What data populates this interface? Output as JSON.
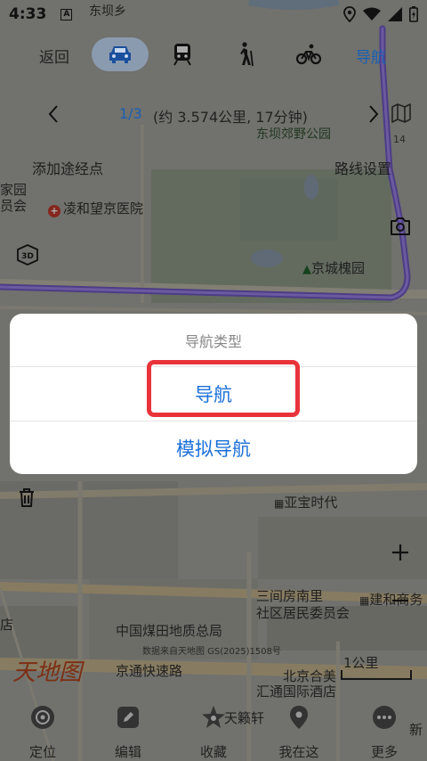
{
  "status_bar": {
    "time": "4:33",
    "notif_letter": "A"
  },
  "navbar": {
    "back": "返回",
    "navigate": "导航"
  },
  "route": {
    "count": "1/3",
    "detail": "(约 3.574公里, 17分钟)"
  },
  "links": {
    "add_waypoint": "添加途经点",
    "route_settings": "路线设置"
  },
  "map_labels": {
    "dongbaxiang": "东坝乡",
    "park": "东坝郊野公园",
    "park_num": "14",
    "jiayuan_1": "家园",
    "jiayuan_2": "员会",
    "hospital": "凌和望京医院",
    "jingcheng_park": "京城槐园",
    "yabao": "亚宝时代",
    "sanjianfang_1": "三间房南里",
    "sanjianfang_2": "社区居民委员会",
    "jianhe": "建和商务",
    "coal_bureau": "中国煤田地质总局",
    "data_source": "数据来自天地图 GS(2025)1508号",
    "expressway": "京通快速路",
    "beijing_hemei": "北京合美",
    "scale": "1公里",
    "huitong": "汇通国际酒店",
    "tianlaixuan": "天籁轩",
    "shop": "店",
    "xin": "新",
    "logo": "天地图"
  },
  "dialog": {
    "title": "导航类型",
    "option_navigate": "导航",
    "option_simulate": "模拟导航"
  },
  "tabs": {
    "locate": "定位",
    "edit": "编辑",
    "favorite": "收藏",
    "here": "我在这",
    "more": "更多"
  },
  "colors": {
    "accent": "#1a6fd8",
    "highlight": "#e8333a",
    "route": "#7b5ec9"
  }
}
